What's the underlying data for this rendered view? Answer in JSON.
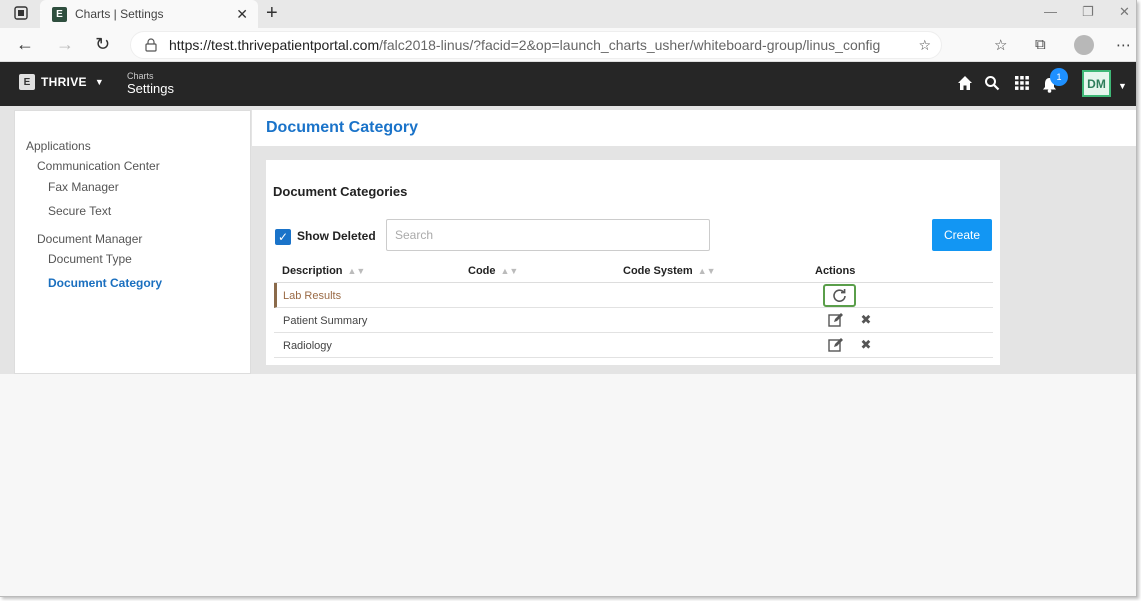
{
  "browser": {
    "tab_title": "Charts | Settings",
    "url_host": "https://test.thrivepatientportal.com",
    "url_path": "/falc2018-linus/?facid=2&op=launch_charts_usher/whiteboard-group/linus_config"
  },
  "app": {
    "brand": "THRIVE",
    "crumb_small": "Charts",
    "crumb_big": "Settings",
    "notification_count": "1",
    "user_initials": "DM"
  },
  "sidebar": {
    "items": [
      {
        "label": "Applications"
      },
      {
        "label": "Communication Center"
      },
      {
        "label": "Fax Manager"
      },
      {
        "label": "Secure Text"
      },
      {
        "label": "Document Manager"
      },
      {
        "label": "Document Type"
      },
      {
        "label": "Document Category"
      }
    ]
  },
  "page": {
    "title": "Document Category",
    "panel_title": "Document Categories",
    "show_deleted_label": "Show Deleted",
    "search_placeholder": "Search",
    "create_label": "Create"
  },
  "table": {
    "columns": [
      "Description",
      "Code",
      "Code System",
      "Actions"
    ],
    "rows": [
      {
        "description": "Lab Results",
        "deleted": true
      },
      {
        "description": "Patient Summary",
        "deleted": false
      },
      {
        "description": "Radiology",
        "deleted": false
      }
    ]
  },
  "colors": {
    "accent": "#1a73c9",
    "create_button": "#1296f3",
    "header_bg": "#262626",
    "restore_highlight": "#5a9e4a"
  }
}
